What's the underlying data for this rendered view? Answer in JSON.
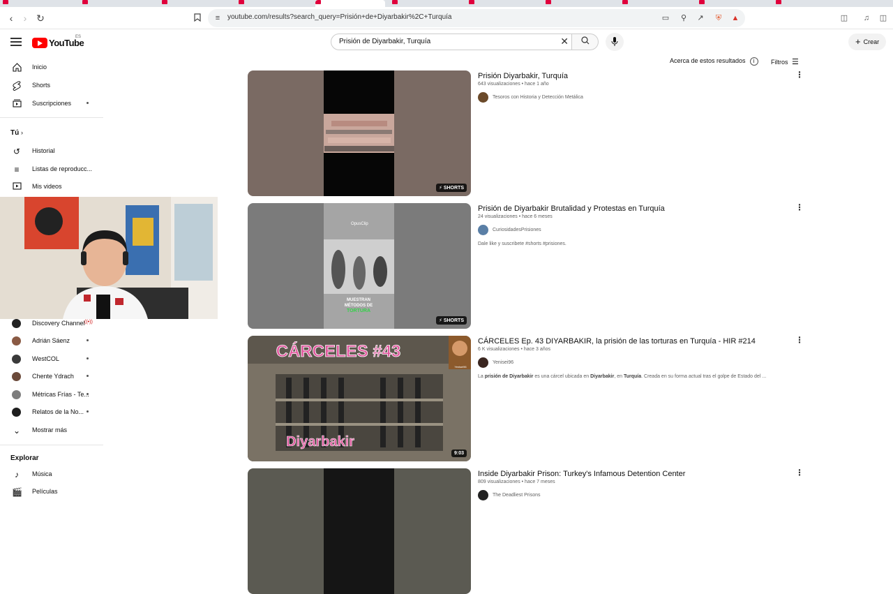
{
  "browser": {
    "url": "youtube.com/results?search_query=Prisión+de+Diyarbakir%2C+Turquía"
  },
  "header": {
    "logo_text": "YouTube",
    "country_code": "ES",
    "search_query": "Prisión de Diyarbakir, Turquía",
    "create_label": "Crear"
  },
  "sidebar": {
    "main": [
      {
        "label": "Inicio",
        "icon": "home-icon"
      },
      {
        "label": "Shorts",
        "icon": "shorts-icon"
      },
      {
        "label": "Suscripciones",
        "icon": "subscriptions-icon"
      }
    ],
    "you_heading": "Tú",
    "you": [
      {
        "label": "Historial",
        "icon": "history-icon"
      },
      {
        "label": "Listas de reproducc...",
        "icon": "playlists-icon"
      },
      {
        "label": "Mis videos",
        "icon": "your-videos-icon"
      }
    ],
    "subscriptions": [
      {
        "label": "Discovery Channel",
        "live": true,
        "avatar_color": "#222222"
      },
      {
        "label": "Adrián Sáenz",
        "avatar_color": "#8a5a44"
      },
      {
        "label": "WestCOL",
        "avatar_color": "#3a3a3a"
      },
      {
        "label": "Chente Ydrach",
        "avatar_color": "#6b4a3a"
      },
      {
        "label": "Métricas Frías - Te...",
        "avatar_color": "#7d7d7d"
      },
      {
        "label": "Relatos de la No...",
        "avatar_color": "#1e1e1e"
      }
    ],
    "show_more": "Mostrar más",
    "explore_heading": "Explorar",
    "explore": [
      {
        "label": "Música",
        "icon": "music-icon"
      },
      {
        "label": "Películas",
        "icon": "movies-icon"
      }
    ]
  },
  "results_bar": {
    "about_label": "Acerca de estos resultados",
    "filters_label": "Filtros"
  },
  "results": [
    {
      "title": "Prisión Diyarbakir, Turquía",
      "views": "643 visualizaciones",
      "age": "hace 1 año",
      "channel": "Tesoros con Historia y Detección Metálica",
      "description": "",
      "badge": "SHORTS"
    },
    {
      "title": "Prisión de Diyarbakir Brutalidad y Protestas en Turquía",
      "views": "24 visualizaciones",
      "age": "hace 6 meses",
      "channel": "CuriosidadesPrisiones",
      "description": "Dale like y suscribete #shorts #prisiones.",
      "badge": "SHORTS",
      "thumb_caption_1": "MUESTRAN",
      "thumb_caption_2": "MÉTODOS DE",
      "thumb_caption_3": "TORTURA",
      "thumb_logo": "OpusClip"
    },
    {
      "title": "CÁRCELES Ep. 43 DIYARBAKIR, la prisión de las torturas en Turquía - HIR #214",
      "views": "6 K visualizaciones",
      "age": "hace 3 años",
      "channel": "Yenisei96",
      "description_parts": [
        "La ",
        "prisión de Diyarbakir",
        " es una cárcel ubicada en ",
        "Diyarbakir",
        ", en ",
        "Turquía",
        ". Creada en su forma actual tras el golpe de Estado del ..."
      ],
      "badge": "9:03",
      "thumb_title": "CÁRCELES #43",
      "thumb_sub": "Diyarbakir",
      "thumb_corner": "Yenisei96"
    },
    {
      "title": "Inside Diyarbakir Prison: Turkey's Infamous Detention Center",
      "views": "809 visualizaciones",
      "age": "hace 7 meses",
      "channel": "The Deadliest Prisons",
      "description": ""
    }
  ]
}
